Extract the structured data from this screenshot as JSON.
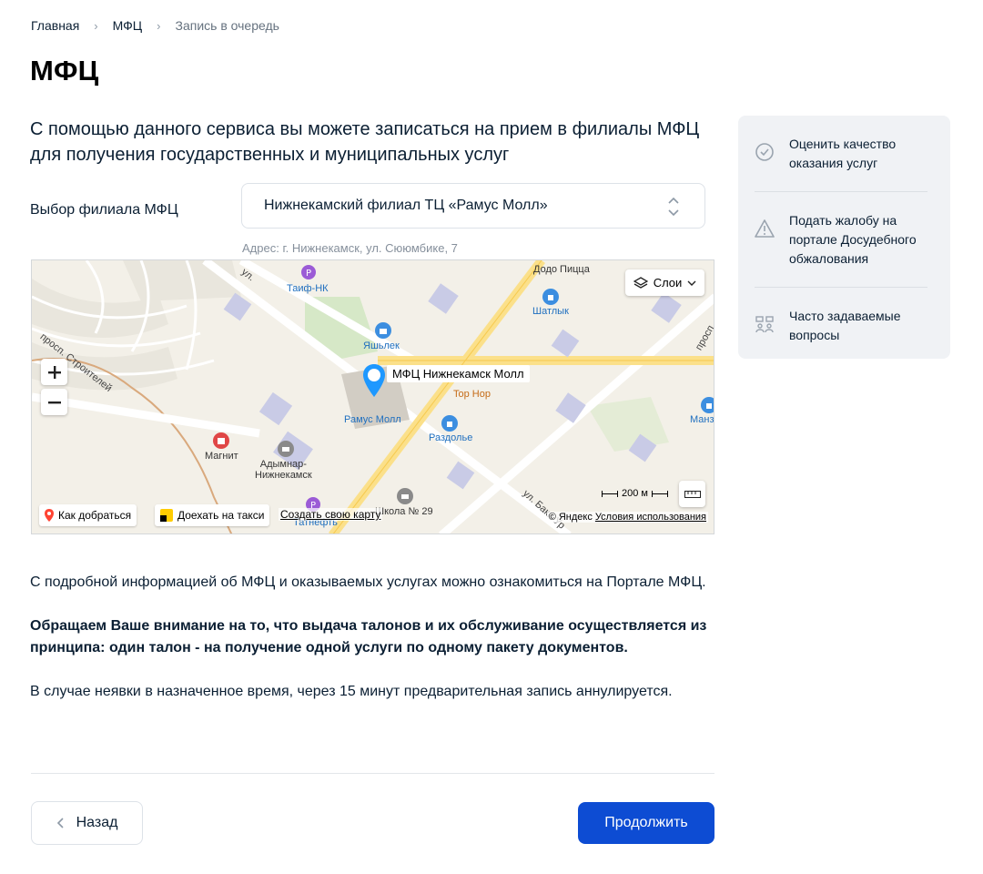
{
  "breadcrumb": {
    "items": [
      "Главная",
      "МФЦ"
    ],
    "current": "Запись в очередь"
  },
  "page": {
    "title": "МФЦ",
    "lead": "С помощью данного сервиса вы можете записаться на прием в филиалы МФЦ для получения государственных и муниципальных услуг"
  },
  "branch": {
    "label": "Выбор филиала МФЦ",
    "selected": "Нижнекамский филиал ТЦ «Рамус Молл»",
    "address": "Адрес: г. Нижнекамск, ул. Сююмбике, 7"
  },
  "map": {
    "pin_label": "МФЦ Нижнекамск Молл",
    "layers_label": "Слои",
    "route_label": "Как добраться",
    "taxi_label": "Доехать на такси",
    "create_map_label": "Создать свою карту",
    "scale_label": "200 м",
    "copyright": "© Яндекс",
    "terms_label": "Условия использования",
    "places": {
      "dodo": "Додо Пицца",
      "taif": "Таиф-НК",
      "shatlyk": "Шатлык",
      "yashlek": "Яшьлек",
      "ramus": "Рамус Молл",
      "tophop": "Top Hop",
      "razdolye": "Раздолье",
      "magnit": "Магнит",
      "adymnar": "Адымнар-\nНижнекамск",
      "school": "Школа № 29",
      "tatneft": "Татнефть",
      "manz": "Манз",
      "stroiteley": "просп. Строителей",
      "ul": "ул.",
      "baki": "ул. Баки Ур",
      "pros": "просп"
    }
  },
  "sidebar": {
    "items": [
      {
        "label": "Оценить качество оказания услуг",
        "icon": "check-circle-icon"
      },
      {
        "label": "Подать жалобу на портале Досудебного обжалования",
        "icon": "warning-icon"
      },
      {
        "label": "Часто задаваемые вопросы",
        "icon": "faq-people-icon"
      }
    ]
  },
  "info": {
    "p1": "С подробной информацией об МФЦ и оказываемых услугах можно ознакомиться на  Портале МФЦ.",
    "p2": "Обращаем Ваше внимание на то, что выдача талонов и их обслуживание осуществляется из принципа: один талон - на получение одной услуги по одному пакету документов.",
    "p3": "В случае неявки в назначенное время, через 15 минут предварительная запись аннулируется."
  },
  "buttons": {
    "back": "Назад",
    "continue": "Продолжить"
  },
  "colors": {
    "primary": "#0d4cd3",
    "text": "#0b1f33",
    "muted": "#86909c",
    "sidebar_bg": "#f0f2f5"
  }
}
